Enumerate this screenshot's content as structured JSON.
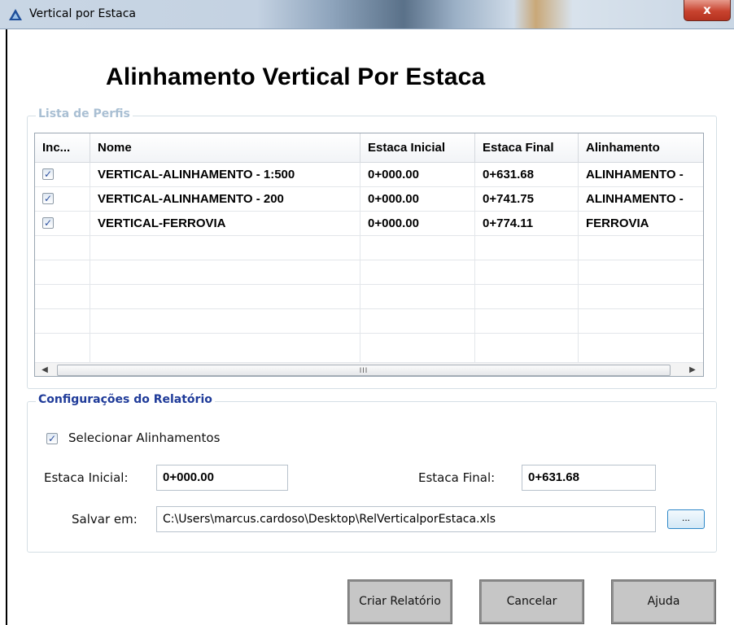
{
  "window": {
    "title": "Vertical por Estaca",
    "close_glyph": "x",
    "app_icon": "autodesk-a-icon"
  },
  "heading": "Alinhamento Vertical Por Estaca",
  "profiles": {
    "legend": "Lista de Perfis",
    "columns": [
      "Inc...",
      "Nome",
      "Estaca Inicial",
      "Estaca Final",
      "Alinhamento"
    ],
    "check_glyph": "✓",
    "rows": [
      {
        "checked": true,
        "name": "VERTICAL-ALINHAMENTO - 1:500",
        "start": "0+000.00",
        "end": "0+631.68",
        "alignment": "ALINHAMENTO -"
      },
      {
        "checked": true,
        "name": "VERTICAL-ALINHAMENTO - 200",
        "start": "0+000.00",
        "end": "0+741.75",
        "alignment": "ALINHAMENTO -"
      },
      {
        "checked": true,
        "name": "VERTICAL-FERROVIA",
        "start": "0+000.00",
        "end": "0+774.11",
        "alignment": "FERROVIA"
      }
    ],
    "scrollbar": {
      "left_arrow": "◀",
      "right_arrow": "▶",
      "grip": "III"
    }
  },
  "settings": {
    "legend": "Configurações do Relatório",
    "select_alignments": {
      "checked": true,
      "label": "Selecionar Alinhamentos"
    },
    "start_label": "Estaca Inicial:",
    "start_value": "0+000.00",
    "end_label": "Estaca Final:",
    "end_value": "0+631.68",
    "save_label": "Salvar em:",
    "save_path": "C:\\Users\\marcus.cardoso\\Desktop\\RelVerticalporEstaca.xls",
    "browse_label": "..."
  },
  "buttons": {
    "create": "Criar Relatório",
    "cancel": "Cancelar",
    "help": "Ajuda"
  }
}
